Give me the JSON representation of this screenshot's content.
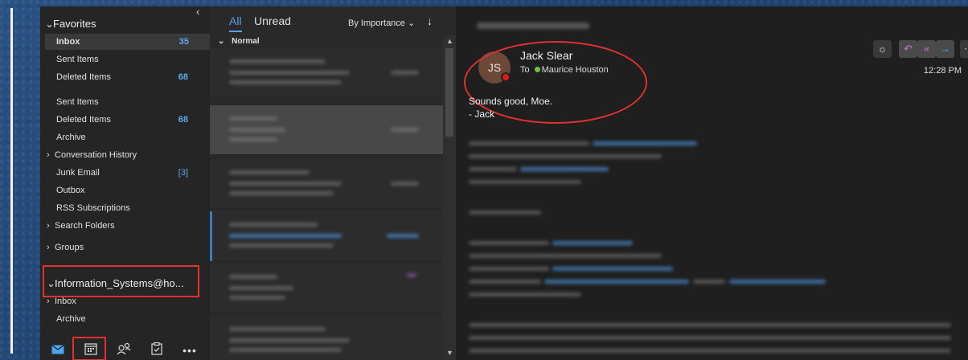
{
  "folders": {
    "favorites_label": "Favorites",
    "items": [
      {
        "label": "Inbox",
        "count": "35"
      },
      {
        "label": "Sent Items",
        "count": ""
      },
      {
        "label": "Deleted Items",
        "count": "68"
      },
      {
        "label": "Sent Items",
        "count": ""
      },
      {
        "label": "Deleted Items",
        "count": "68"
      },
      {
        "label": "Archive",
        "count": ""
      },
      {
        "label": "Conversation History",
        "count": ""
      },
      {
        "label": "Junk Email",
        "count": "[3]"
      },
      {
        "label": "Outbox",
        "count": ""
      },
      {
        "label": "RSS Subscriptions",
        "count": ""
      },
      {
        "label": "Search Folders",
        "count": ""
      },
      {
        "label": "Groups",
        "count": ""
      }
    ],
    "account_label": "Information_Systems@ho...",
    "account_items": [
      {
        "label": "Inbox"
      },
      {
        "label": "Archive"
      }
    ]
  },
  "nav": {
    "icons": [
      "mail-icon",
      "calendar-icon",
      "people-icon",
      "tasks-icon",
      "more-icon"
    ]
  },
  "list": {
    "tab_all": "All",
    "tab_unread": "Unread",
    "sort_label": "By Importance",
    "group_header": "Normal"
  },
  "reading": {
    "avatar_initials": "JS",
    "sender_name": "Jack Slear",
    "to_label": "To",
    "recipient": "Maurice Houston",
    "time": "12:28 PM",
    "body_line_1": "Sounds good, Moe.",
    "body_line_2": "- Jack"
  },
  "colors": {
    "accent": "#5aa2e6",
    "highlight_box": "#e03030",
    "presence_busy": "#d91d1d",
    "presence_available": "#6bc24a"
  }
}
